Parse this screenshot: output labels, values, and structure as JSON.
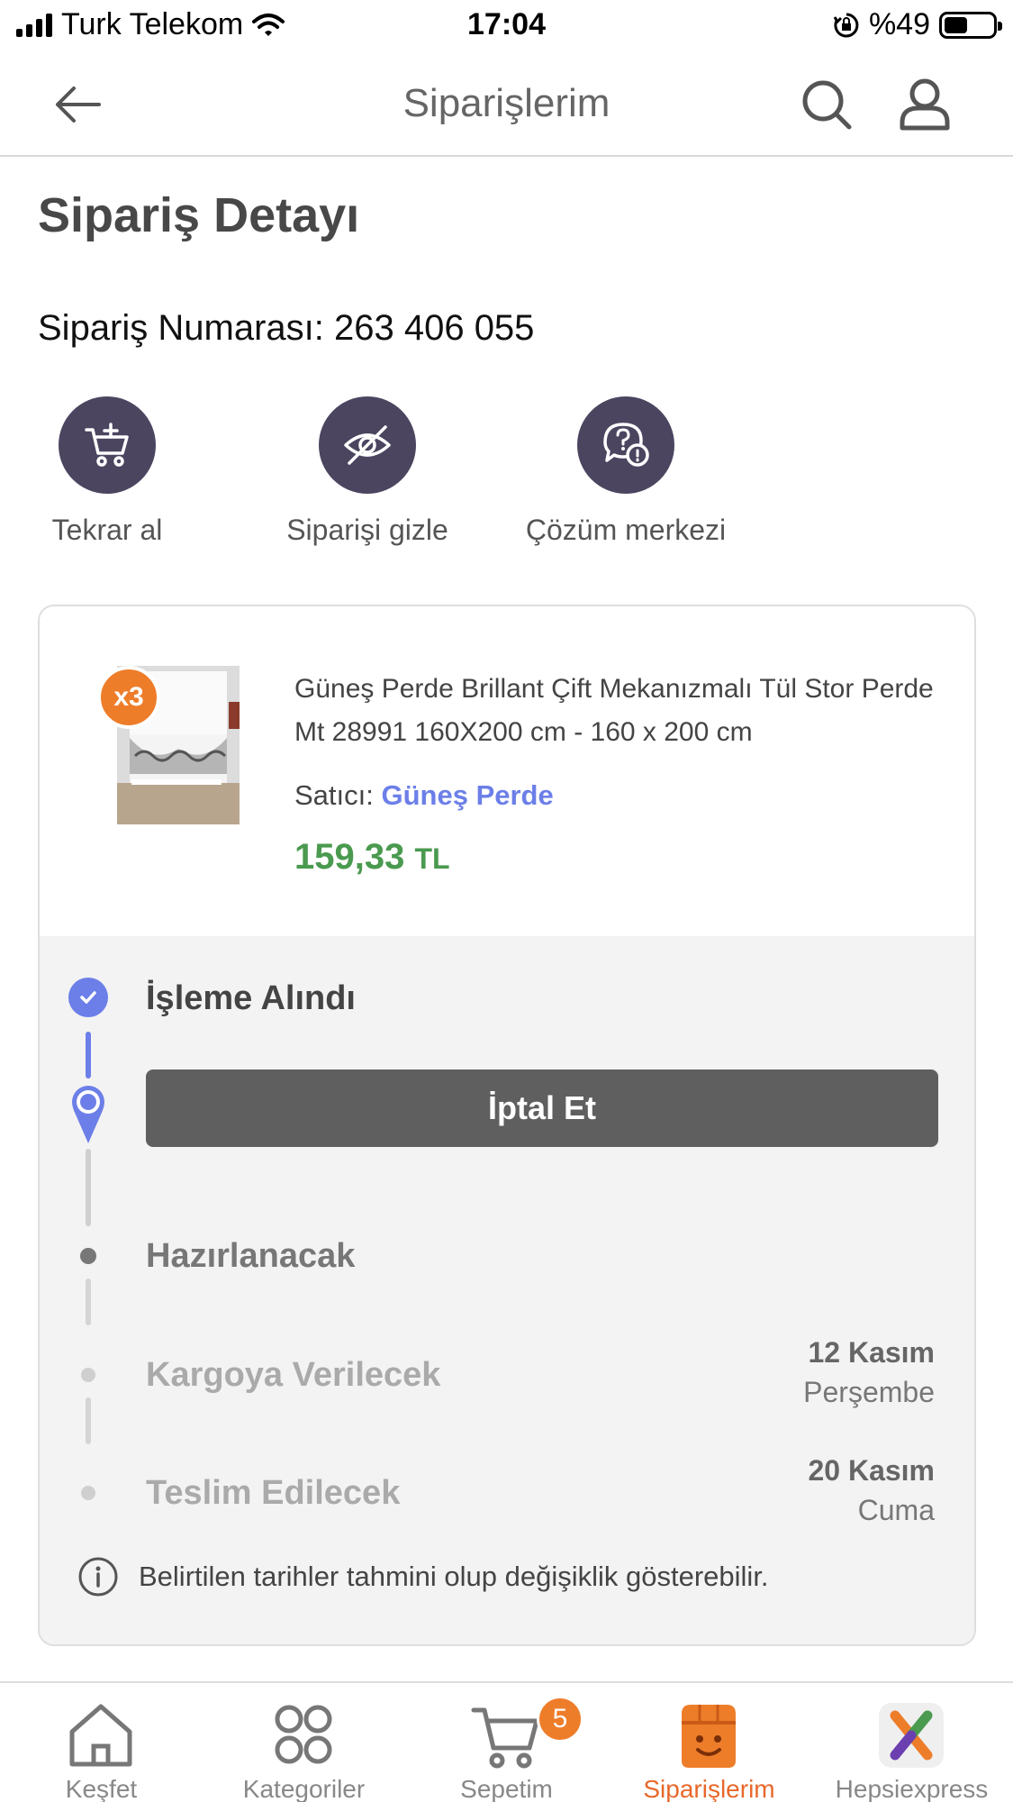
{
  "status_bar": {
    "carrier": "Turk Telekom",
    "time": "17:04",
    "battery": "%49",
    "battery_level": 0.49
  },
  "nav": {
    "title": "Siparişlerim",
    "back_icon": "arrow-left-icon",
    "search_icon": "search-icon",
    "user_icon": "user-icon"
  },
  "page": {
    "title": "Sipariş Detayı",
    "order_number": "Sipariş Numarası: 263 406 055"
  },
  "actions": [
    {
      "label": "Tekrar al",
      "icon": "cart-plus-icon"
    },
    {
      "label": "Siparişi gizle",
      "icon": "eye-off-icon"
    },
    {
      "label": "Çözüm merkezi",
      "icon": "help-chat-icon"
    }
  ],
  "product": {
    "quantity_badge": "x3",
    "name": "Güneş Perde Brillant Çift Mekanızmalı Tül Stor Perde Mt 28991 160X200 cm - 160 x 200 cm",
    "seller_label": "Satıcı:",
    "seller_name": "Güneş Perde",
    "price": "159,33",
    "currency": "TL"
  },
  "timeline": {
    "steps": [
      {
        "title": "İşleme Alındı",
        "state": "done",
        "date_day": "",
        "date_weekday": ""
      },
      {
        "title": "Hazırlanacak",
        "state": "next",
        "date_day": "",
        "date_weekday": ""
      },
      {
        "title": "Kargoya Verilecek",
        "state": "pending",
        "date_day": "12 Kasım",
        "date_weekday": "Perşembe"
      },
      {
        "title": "Teslim Edilecek",
        "state": "pending",
        "date_day": "20 Kasım",
        "date_weekday": "Cuma"
      }
    ],
    "cancel_label": "İptal Et",
    "note": "Belirtilen tarihler tahmini olup değişiklik gösterebilir."
  },
  "tabbar": {
    "tabs": [
      {
        "label": "Keşfet",
        "icon": "home-icon",
        "active": false
      },
      {
        "label": "Kategoriler",
        "icon": "grid-icon",
        "active": false
      },
      {
        "label": "Sepetim",
        "icon": "cart-icon",
        "active": false,
        "badge": "5"
      },
      {
        "label": "Siparişlerim",
        "icon": "orders-box-icon",
        "active": true
      },
      {
        "label": "Hepsiexpress",
        "icon": "hepsiexpress-logo-icon",
        "active": false
      }
    ]
  },
  "colors": {
    "accent_orange": "#ee7d2a",
    "accent_blue": "#6c7fe8",
    "price_green": "#4a9a4f",
    "action_circle": "#4b4560",
    "cancel_button": "#5f5f5f"
  }
}
